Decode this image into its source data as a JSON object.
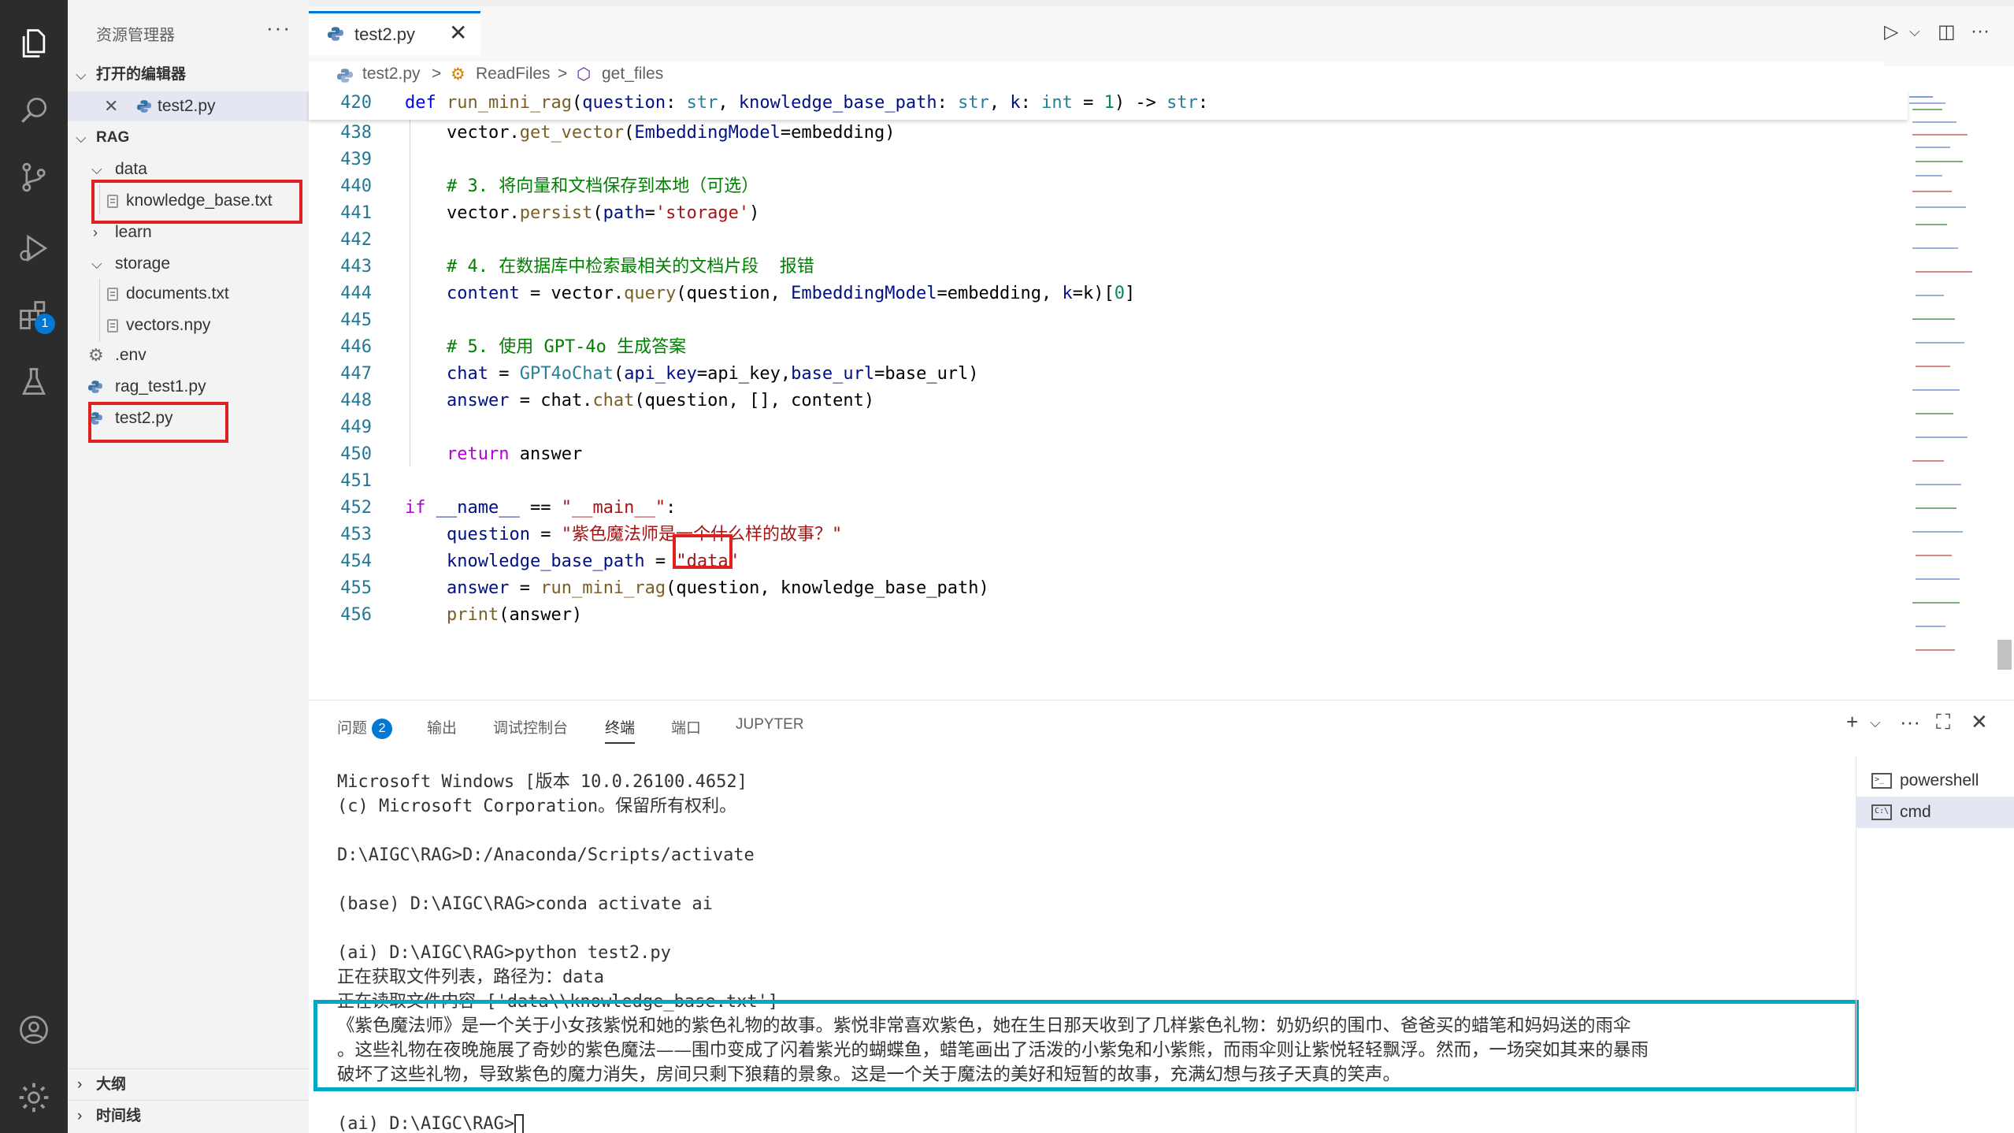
{
  "explorer": {
    "title": "资源管理器",
    "more": "···",
    "open_editors_header": "打开的编辑器",
    "open_editor_file": "test2.py",
    "close_glyph": "✕",
    "project_header": "RAG",
    "tree": {
      "data_folder": "data",
      "knowledge_file": "knowledge_base.txt",
      "learn_folder": "learn",
      "storage_folder": "storage",
      "documents_file": "documents.txt",
      "vectors_file": "vectors.npy",
      "env_file": ".env",
      "rag_test1_file": "rag_test1.py",
      "test2_file": "test2.py"
    },
    "outline_header": "大纲",
    "timeline_header": "时间线"
  },
  "activity": {
    "extensions_badge": "1"
  },
  "tab": {
    "name": "test2.py",
    "close": "✕"
  },
  "breadcrumb": {
    "file": "test2.py",
    "class": "ReadFiles",
    "method": "get_files",
    "sep": ">"
  },
  "editor": {
    "sticky_line": {
      "num": "420"
    },
    "lines": [
      {
        "num": "438"
      },
      {
        "num": "439"
      },
      {
        "num": "440"
      },
      {
        "num": "441"
      },
      {
        "num": "442"
      },
      {
        "num": "443"
      },
      {
        "num": "444"
      },
      {
        "num": "445"
      },
      {
        "num": "446"
      },
      {
        "num": "447"
      },
      {
        "num": "448"
      },
      {
        "num": "449"
      },
      {
        "num": "450"
      },
      {
        "num": "451"
      },
      {
        "num": "452"
      },
      {
        "num": "453"
      },
      {
        "num": "454"
      },
      {
        "num": "455"
      },
      {
        "num": "456"
      }
    ]
  },
  "panel": {
    "tabs": {
      "problems": "问题",
      "problems_count": "2",
      "output": "输出",
      "debug_console": "调试控制台",
      "terminal": "终端",
      "ports": "端口",
      "jupyter": "JUPYTER"
    },
    "terminals": {
      "powershell": "powershell",
      "cmd": "cmd"
    },
    "terminal_lines": {
      "l1": "Microsoft Windows [版本 10.0.26100.4652]",
      "l2": "(c) Microsoft Corporation。保留所有权利。",
      "l3": "D:\\AIGC\\RAG>D:/Anaconda/Scripts/activate",
      "l4": "(base) D:\\AIGC\\RAG>conda activate ai",
      "l5": "(ai) D:\\AIGC\\RAG>python test2.py",
      "l6": "正在获取文件列表，路径为：data",
      "l7": "正在读取文件内容 ['data\\\\knowledge_base.txt']",
      "l8": "《紫色魔法师》是一个关于小女孩紫悦和她的紫色礼物的故事。紫悦非常喜欢紫色，她在生日那天收到了几样紫色礼物：奶奶织的围巾、爸爸买的蜡笔和妈妈送的雨伞",
      "l9": "。这些礼物在夜晚施展了奇妙的紫色魔法——围巾变成了闪着紫光的蝴蝶鱼，蜡笔画出了活泼的小紫兔和小紫熊，而雨伞则让紫悦轻轻飘浮。然而，一场突如其来的暴雨",
      "l10": "破坏了这些礼物，导致紫色的魔力消失，房间只剩下狼藉的景象。这是一个关于魔法的美好和短暂的故事，充满幻想与孩子天真的笑声。",
      "l11": "(ai) D:\\AIGC\\RAG>"
    }
  }
}
